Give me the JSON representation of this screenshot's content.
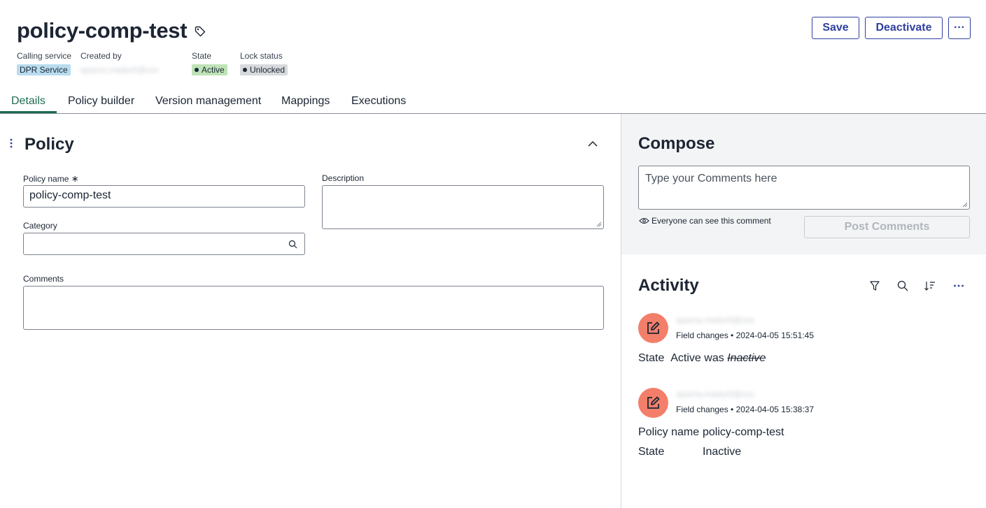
{
  "header": {
    "title": "policy-comp-test",
    "meta": {
      "calling_service_label": "Calling service",
      "calling_service_value": "DPR Service",
      "created_by_label": "Created by",
      "created_by_value": "aparna.madur5@xxx",
      "state_label": "State",
      "state_value": "Active",
      "lock_label": "Lock status",
      "lock_value": "Unlocked"
    },
    "buttons": {
      "save": "Save",
      "deactivate": "Deactivate",
      "more": "···"
    }
  },
  "tabs": [
    "Details",
    "Policy builder",
    "Version management",
    "Mappings",
    "Executions"
  ],
  "policy": {
    "section_title": "Policy",
    "name_label": "Policy name",
    "required_marker": "∗",
    "name_value": "policy-comp-test",
    "description_label": "Description",
    "description_value": "",
    "category_label": "Category",
    "category_value": "",
    "comments_label": "Comments",
    "comments_value": ""
  },
  "compose": {
    "title": "Compose",
    "placeholder": "Type your Comments here",
    "visibility": "Everyone can see this comment",
    "post_button": "Post Comments"
  },
  "activity": {
    "title": "Activity",
    "entries": [
      {
        "user": "aparna.madur5@xxx",
        "meta": "Field changes • 2024-04-05 15:51:45",
        "field": "State",
        "new_value": "Active",
        "was": "was",
        "old_value": "Inactive"
      },
      {
        "user": "aparna.madur5@xxx",
        "meta": "Field changes • 2024-04-05 15:38:37",
        "field1": "Policy name",
        "value1": "policy-comp-test",
        "field2": "State",
        "value2": "Inactive"
      }
    ]
  },
  "colors": {
    "accent": "#2f3fa0",
    "tab_active": "#1f6b52",
    "service_badge": "#b9dcef",
    "active_badge": "#bfe3b8",
    "unlocked_badge": "#d7d9dc",
    "avatar": "#f37f6a"
  }
}
